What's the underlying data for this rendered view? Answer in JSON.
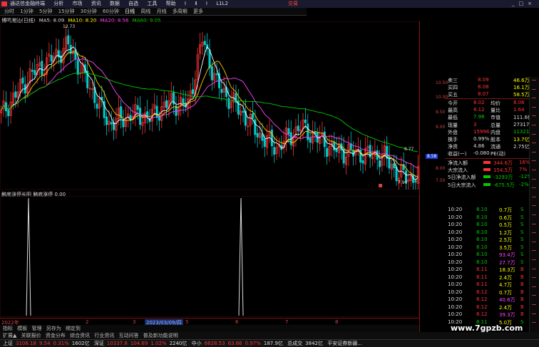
{
  "titlebar": {
    "menu": [
      "通达信金融终端",
      "分析",
      "市场",
      "资讯",
      "数据",
      "自选",
      "工具",
      "帮助",
      "Ⅰ",
      "Ⅱ",
      "Ⅰ",
      "L1L2"
    ],
    "trade": "交易"
  },
  "periods": [
    "分时",
    "1分钟",
    "5分钟",
    "15分钟",
    "30分钟",
    "60分钟",
    "日线",
    "周线",
    "月线",
    "多周期",
    "更多"
  ],
  "active_period": "日线",
  "chartinfo": {
    "name": "博鸣潮汕(日线)",
    "ma5": "MA5: 8.09",
    "ma10": "MA10: 8.20",
    "ma20": "MA20: 8.56",
    "ma60": "MA60: 9.05"
  },
  "indinfo": {
    "name": "触底涨停长阳 触底涨停",
    "value": "0.00"
  },
  "axis_labels": [
    "10.50",
    "10.00",
    "9.50",
    "9.00",
    "8.58",
    "8.00",
    "7.50"
  ],
  "price_annotations": {
    "high": "12.73",
    "mid": "8.77",
    "low": "7.90"
  },
  "orderbook": [
    {
      "label": "卖三",
      "price": "8.09",
      "vol": "46.6万"
    },
    {
      "label": "买四",
      "price": "8.08",
      "vol": "16.1万"
    },
    {
      "label": "买五",
      "price": "8.07",
      "vol": "58.5万"
    }
  ],
  "stats": [
    {
      "a": "今开",
      "av": "8.02",
      "b": "均价",
      "bv": "8.06"
    },
    {
      "a": "最高",
      "av": "8.12",
      "b": "量比",
      "bv": "1.64"
    },
    {
      "a": "最低",
      "av": "7.96",
      "b": "市值",
      "bv": "111.6亿"
    },
    {
      "a": "现量",
      "av": "3",
      "b": "总量",
      "bv": "27317"
    },
    {
      "a": "外盘",
      "av": "15996",
      "b": "内盘",
      "bv": "11321"
    },
    {
      "a": "换手",
      "av": "0.99%",
      "b": "股本",
      "bv": "13.7亿"
    },
    {
      "a": "净资",
      "av": "4.86",
      "b": "流通",
      "bv": "2.75亿"
    },
    {
      "a": "收益(一)",
      "av": "-0.080",
      "b": "PE(动)",
      "bv": ""
    }
  ],
  "flows": [
    {
      "label": "净流入额",
      "v": "344.6万",
      "p": "16%"
    },
    {
      "label": "大宗流入",
      "v": "154.5万",
      "p": "7%"
    },
    {
      "label": "5日净流入额",
      "v": "-3293万",
      "p": "-12%"
    },
    {
      "label": "5日大宗流入",
      "v": "-675.5万",
      "p": "-2%"
    }
  ],
  "trades": [
    {
      "t": "10:20",
      "p": "8.10",
      "v": "0.7万",
      "s": "S"
    },
    {
      "t": "10:20",
      "p": "8.10",
      "v": "0.6万",
      "s": "S"
    },
    {
      "t": "10:20",
      "p": "8.10",
      "v": "0.5万",
      "s": "S"
    },
    {
      "t": "10:20",
      "p": "8.10",
      "v": "1.2万",
      "s": "S"
    },
    {
      "t": "10:20",
      "p": "8.10",
      "v": "2.5万",
      "s": "S"
    },
    {
      "t": "10:20",
      "p": "8.10",
      "v": "3.5万",
      "s": "S"
    },
    {
      "t": "10:20",
      "p": "8.10",
      "v": "93.4万",
      "s": "S"
    },
    {
      "t": "10:20",
      "p": "8.10",
      "v": "27.7万",
      "s": "S"
    },
    {
      "t": "10:20",
      "p": "8.11",
      "v": "18.3万",
      "s": "B"
    },
    {
      "t": "10:20",
      "p": "8.11",
      "v": "2.4万",
      "s": "B"
    },
    {
      "t": "10:20",
      "p": "8.11",
      "v": "4.7万",
      "s": "B"
    },
    {
      "t": "10:20",
      "p": "8.12",
      "v": "0.7万",
      "s": "B"
    },
    {
      "t": "10:20",
      "p": "8.12",
      "v": "40.6万",
      "s": "B"
    },
    {
      "t": "10:20",
      "p": "8.12",
      "v": "2.4万",
      "s": "B"
    },
    {
      "t": "10:20",
      "p": "8.12",
      "v": "39.3万",
      "s": "B"
    },
    {
      "t": "10:20",
      "p": "8.11",
      "v": "5.0万",
      "s": "S"
    }
  ],
  "xaxis": [
    "2022年",
    "2",
    "3",
    "2023/03/09/四",
    "5",
    "6",
    "7",
    "8"
  ],
  "btmtabs": [
    "指标",
    "模板",
    "管理",
    "另存为",
    "绑定到"
  ],
  "tabs2": [
    "扩展▲",
    "关联报价",
    "资金分布",
    "综合资讯",
    "行业资讯",
    "互动问答",
    "普及新功能说明"
  ],
  "statusbar": {
    "sh": "上证",
    "shv": "3108.18",
    "shc": "9.54",
    "shp": "0.31%",
    "sha": "1602亿",
    "sz": "深证",
    "szv": "10337.8",
    "szc": "104.69",
    "szp": "1.02%",
    "sza": "2240亿",
    "zx": "中小",
    "zxv": "6628.53",
    "zxc": "63.66",
    "zxp": "0.97%",
    "zxa": "187.9亿",
    "zj": "总成交",
    "zjv": "3842亿",
    "broker": "平安证券新疆..."
  },
  "watermark": "www.7gpzb.com",
  "colors": {
    "up": "#ff3333",
    "down": "#00cccc",
    "ma5": "#ffffff",
    "ma10": "#ffcc00",
    "ma20": "#ff44ff",
    "ma60": "#00cc00"
  }
}
